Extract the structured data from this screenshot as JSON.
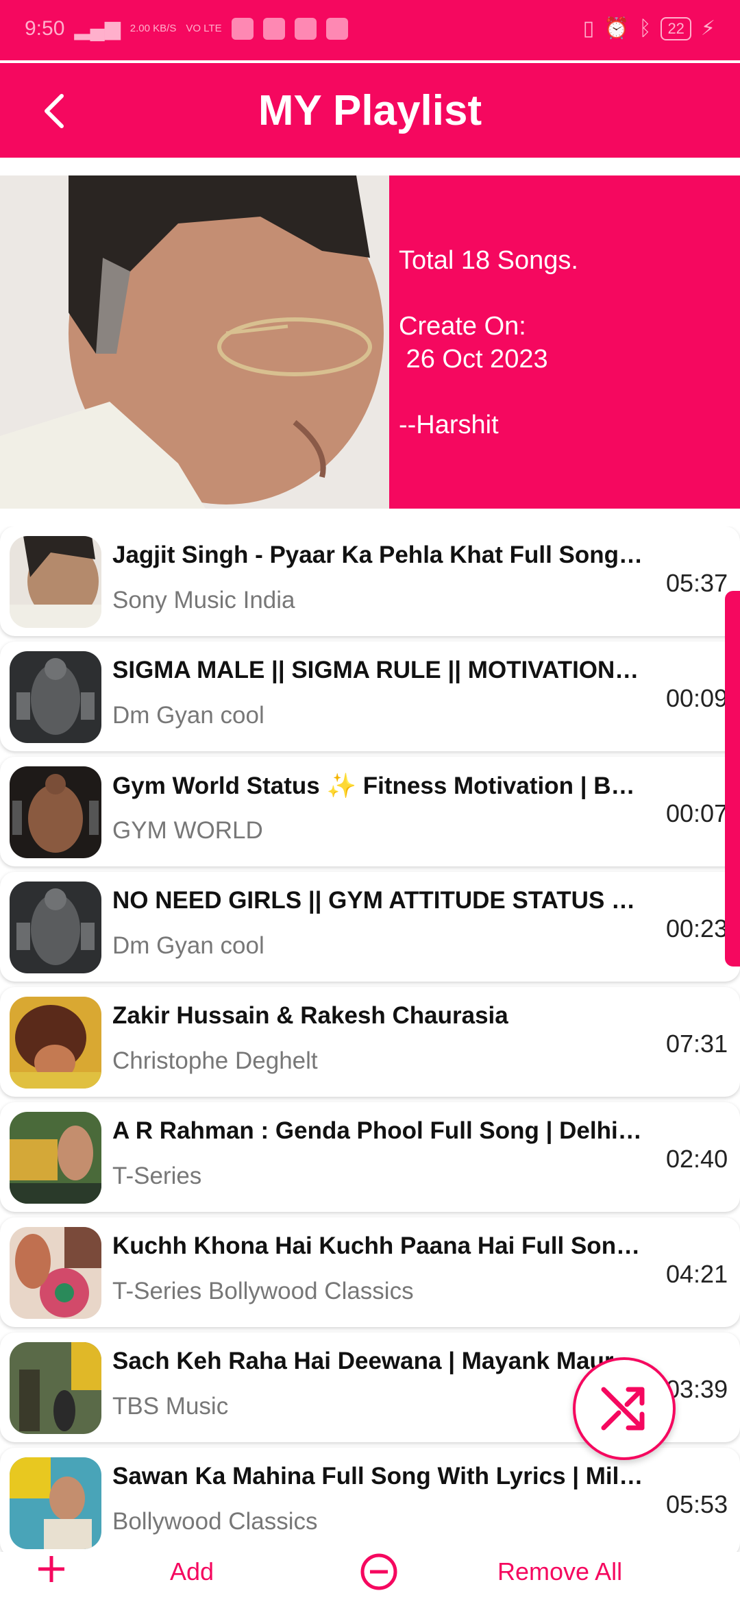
{
  "status_bar": {
    "time": "9:50",
    "net_speed": "2.00 KB/S",
    "volte": "VO LTE",
    "battery": "22",
    "icons": [
      "signal-icon",
      "vibrate-icon",
      "alarm-icon",
      "bluetooth-icon",
      "battery-icon",
      "charging-icon"
    ]
  },
  "appbar": {
    "title": "MY Playlist",
    "back_icon": "back-arrow-icon"
  },
  "playlist_info": {
    "total": "Total 18 Songs.",
    "created_label": "Create On:",
    "created_date": " 26 Oct 2023",
    "creator": "--Harshit"
  },
  "songs": [
    {
      "title": "Jagjit Singh - Pyaar Ka Pehla Khat Full Song …",
      "artist": "Sony Music India",
      "duration": "05:37",
      "thumb_color": "#b48a6c"
    },
    {
      "title": "SIGMA MALE || SIGMA RULE || MOTIVATION…",
      "artist": "Dm Gyan cool",
      "duration": "00:09",
      "thumb_color": "#3a3c3e"
    },
    {
      "title": "Gym World Status ✨ Fitness Motivation | B…",
      "artist": "GYM WORLD",
      "duration": "00:07",
      "thumb_color": "#2a2522"
    },
    {
      "title": "NO NEED GIRLS  || GYM ATTITUDE STATUS  …",
      "artist": "Dm Gyan cool",
      "duration": "00:23",
      "thumb_color": "#3a3c3e"
    },
    {
      "title": "Zakir Hussain & Rakesh Chaurasia",
      "artist": "Christophe Deghelt",
      "duration": "07:31",
      "thumb_color": "#b23a1e"
    },
    {
      "title": "A R Rahman : Genda Phool Full Song  | Delhi …",
      "artist": "T-Series",
      "duration": "02:40",
      "thumb_color": "#c9a23a"
    },
    {
      "title": "Kuchh Khona Hai Kuchh Paana Hai Full Song…",
      "artist": "T-Series Bollywood Classics",
      "duration": "04:21",
      "thumb_color": "#d07a8a"
    },
    {
      "title": "Sach Keh Raha Hai Deewana | Mayank Maur…",
      "artist": "TBS Music",
      "duration": "03:39",
      "thumb_color": "#6a7a4a"
    },
    {
      "title": "Sawan Ka Mahina Full Song With Lyrics | Mil…",
      "artist": "Bollywood Classics",
      "duration": "05:53",
      "thumb_color": "#49a4b8"
    }
  ],
  "fab": {
    "icon": "shuffle-icon"
  },
  "bottom_bar": {
    "add_icon": "plus-icon",
    "add_label": "Add",
    "remove_icon": "minus-circle-icon",
    "remove_label": "Remove All"
  },
  "colors": {
    "accent": "#f5085f",
    "text": "#111111",
    "subtext": "#777777"
  }
}
